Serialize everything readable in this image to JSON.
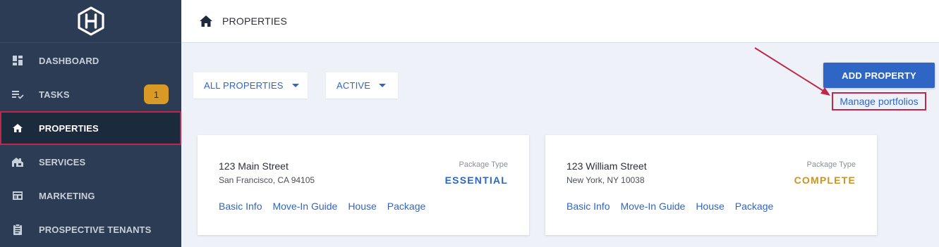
{
  "sidebar": {
    "items": [
      {
        "label": "DASHBOARD",
        "icon": "dashboard-icon"
      },
      {
        "label": "TASKS",
        "icon": "tasks-icon",
        "badge": "1"
      },
      {
        "label": "PROPERTIES",
        "icon": "home-icon"
      },
      {
        "label": "SERVICES",
        "icon": "services-icon"
      },
      {
        "label": "MARKETING",
        "icon": "marketing-icon"
      },
      {
        "label": "PROSPECTIVE TENANTS",
        "icon": "clipboard-icon"
      }
    ]
  },
  "header": {
    "title": "PROPERTIES"
  },
  "filters": {
    "properties": "ALL PROPERTIES",
    "status": "ACTIVE"
  },
  "actions": {
    "add_property": "ADD PROPERTY",
    "manage_portfolios": "Manage portfolios"
  },
  "cards": [
    {
      "street": "123 Main Street",
      "city": "San Francisco, CA 94105",
      "package_label": "Package Type",
      "package_value": "ESSENTIAL",
      "links": [
        "Basic Info",
        "Move-In Guide",
        "House",
        "Package"
      ]
    },
    {
      "street": "123 William Street",
      "city": "New York, NY 10038",
      "package_label": "Package Type",
      "package_value": "COMPLETE",
      "links": [
        "Basic Info",
        "Move-In Guide",
        "House",
        "Package"
      ]
    }
  ],
  "colors": {
    "sidebar_bg": "#2c3c54",
    "accent_blue": "#2f66c5",
    "essential": "#2f66c5",
    "complete": "#c89425",
    "badge": "#d89a24",
    "annotation": "#c0274a"
  }
}
